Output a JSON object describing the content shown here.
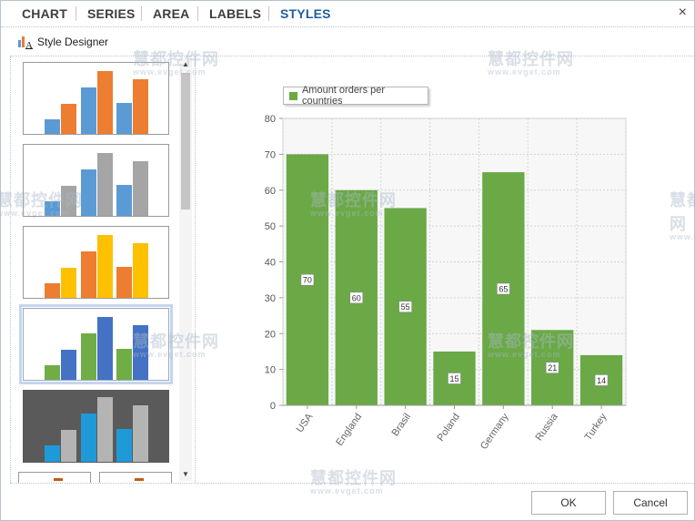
{
  "tabs": [
    {
      "label": "CHART",
      "active": false
    },
    {
      "label": "SERIES",
      "active": false
    },
    {
      "label": "AREA",
      "active": false
    },
    {
      "label": "LABELS",
      "active": false
    },
    {
      "label": "STYLES",
      "active": true
    }
  ],
  "close_glyph": "×",
  "toolbar": {
    "designer_label": "Style Designer",
    "designer_icon": "chart-style-icon"
  },
  "styles": [
    {
      "colors": [
        "#5b9bd5",
        "#ed7d31"
      ],
      "selected": false,
      "dark": false
    },
    {
      "colors": [
        "#5b9bd5",
        "#a5a5a5"
      ],
      "selected": false,
      "dark": false
    },
    {
      "colors": [
        "#ed7d31",
        "#ffc000"
      ],
      "selected": false,
      "dark": false
    },
    {
      "colors": [
        "#4472c4",
        "#70ad47"
      ],
      "selected": true,
      "dark": false
    },
    {
      "colors": [
        "#1f9ad8",
        "#b4b4b4"
      ],
      "selected": false,
      "dark": true
    }
  ],
  "chart_data": {
    "type": "bar",
    "categories": [
      "USA",
      "England",
      "Brasil",
      "Poland",
      "Germany",
      "Russia",
      "Turkey"
    ],
    "series": [
      {
        "name": "Amount orders per countries",
        "values": [
          70,
          60,
          55,
          15,
          65,
          21,
          14
        ],
        "color": "#6aa946"
      }
    ],
    "y_ticks": [
      0,
      10,
      20,
      30,
      40,
      50,
      60,
      70,
      80
    ],
    "ylim": [
      0,
      80
    ],
    "grid": true,
    "legend_position": "top-left",
    "data_labels": true
  },
  "buttons": {
    "ok": "OK",
    "cancel": "Cancel"
  },
  "watermark": {
    "text": "慧都控件网",
    "sub": "www.evget.com"
  }
}
